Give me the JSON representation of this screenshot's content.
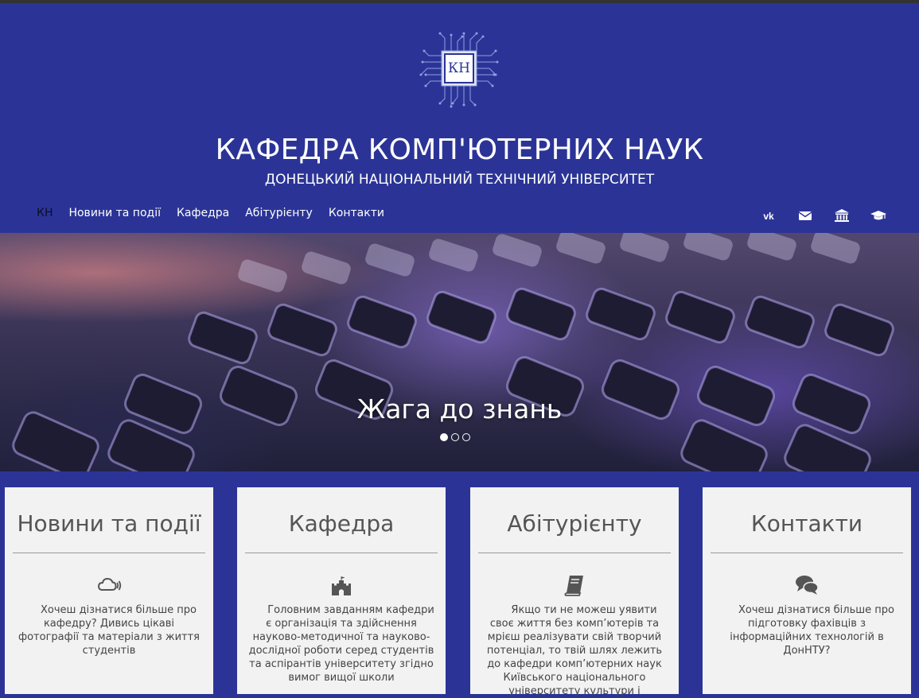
{
  "header": {
    "logo_text": "КН",
    "title": "КАФЕДРА КОМП'ЮТЕРНИХ НАУК",
    "subtitle": "ДОНЕЦЬКИЙ НАЦІОНАЛЬНИЙ ТЕХНІЧНИЙ УНІВЕРСИТЕТ"
  },
  "nav": {
    "brand": "КН",
    "items": [
      "Новини та події",
      "Кафедра",
      "Абітурієнту",
      "Контакти"
    ]
  },
  "social": [
    "vk-icon",
    "envelope-icon",
    "university-icon",
    "graduation-cap-icon"
  ],
  "hero": {
    "caption": "Жага до знань",
    "slides": 3,
    "active_slide": 1
  },
  "cards": [
    {
      "title": "Новини та події",
      "icon": "cloud-icon",
      "text": "Хочеш дізнатися більше про кафедру? Дивись цікаві фотографії та матеріали з життя студентів"
    },
    {
      "title": "Кафедра",
      "icon": "castle-icon",
      "text": "Головним завданням кафедри є організація та здійснення науково-методичної та науково-дослідної роботи серед студентів та аспірантів університету згідно вимог вищої школи"
    },
    {
      "title": "Абітурієнту",
      "icon": "book-icon",
      "text": "Якщо ти не можеш уявити своє життя без комп’ютерів та мрієш реалізувати свій творчий потенціал, то твій шлях лежить до кафедри комп’ютерних наук Київського національного університету культури і"
    },
    {
      "title": "Контакти",
      "icon": "comments-icon",
      "text": "Хочеш дізнатися більше про підготовку фахівців з інформаційних технологій в ДонНТУ?"
    }
  ],
  "colors": {
    "brand_blue": "#2b3496",
    "card_bg": "#f2f2f2",
    "icon_gray": "#555555"
  }
}
